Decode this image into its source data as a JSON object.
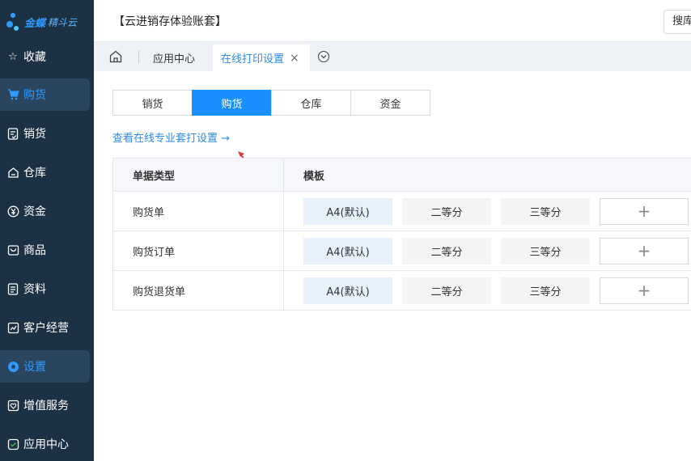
{
  "brand": {
    "name": "金蝶",
    "product": "精斗云"
  },
  "sidebar": {
    "items": [
      {
        "label": "收藏",
        "icon": "star-icon"
      },
      {
        "label": "购货",
        "icon": "cart-icon",
        "active": true
      },
      {
        "label": "销货",
        "icon": "sales-doc-icon"
      },
      {
        "label": "仓库",
        "icon": "warehouse-icon"
      },
      {
        "label": "资金",
        "icon": "yen-icon"
      },
      {
        "label": "商品",
        "icon": "goods-icon"
      },
      {
        "label": "资料",
        "icon": "data-icon"
      },
      {
        "label": "客户经营",
        "icon": "chart-icon"
      },
      {
        "label": "设置",
        "icon": "settings-icon",
        "active": true
      },
      {
        "label": "增值服务",
        "icon": "service-icon"
      },
      {
        "label": "应用中心",
        "icon": "app-icon"
      }
    ]
  },
  "topbar": {
    "title": "【云进销存体验账套】",
    "search_label": "搜库"
  },
  "tabbar": {
    "app_center": "应用中心",
    "current": "在线打印设置",
    "close": "×"
  },
  "segments": {
    "items": [
      "销货",
      "购货",
      "仓库",
      "资金"
    ],
    "active": "购货"
  },
  "pro_link": "查看在线专业套打设置 →",
  "table": {
    "headers": {
      "type": "单据类型",
      "template": "模板"
    },
    "rows": [
      {
        "type": "购货单",
        "templates": [
          "A4(默认)",
          "二等分",
          "三等分"
        ]
      },
      {
        "type": "购货订单",
        "templates": [
          "A4(默认)",
          "二等分",
          "三等分"
        ]
      },
      {
        "type": "购货退货单",
        "templates": [
          "A4(默认)",
          "二等分",
          "三等分"
        ]
      }
    ],
    "add_symbol": "+"
  },
  "colors": {
    "sidebar_bg": "#1d3145",
    "accent": "#1890ff",
    "link": "#2f8ae6",
    "annotation_arrow": "#e53935"
  }
}
